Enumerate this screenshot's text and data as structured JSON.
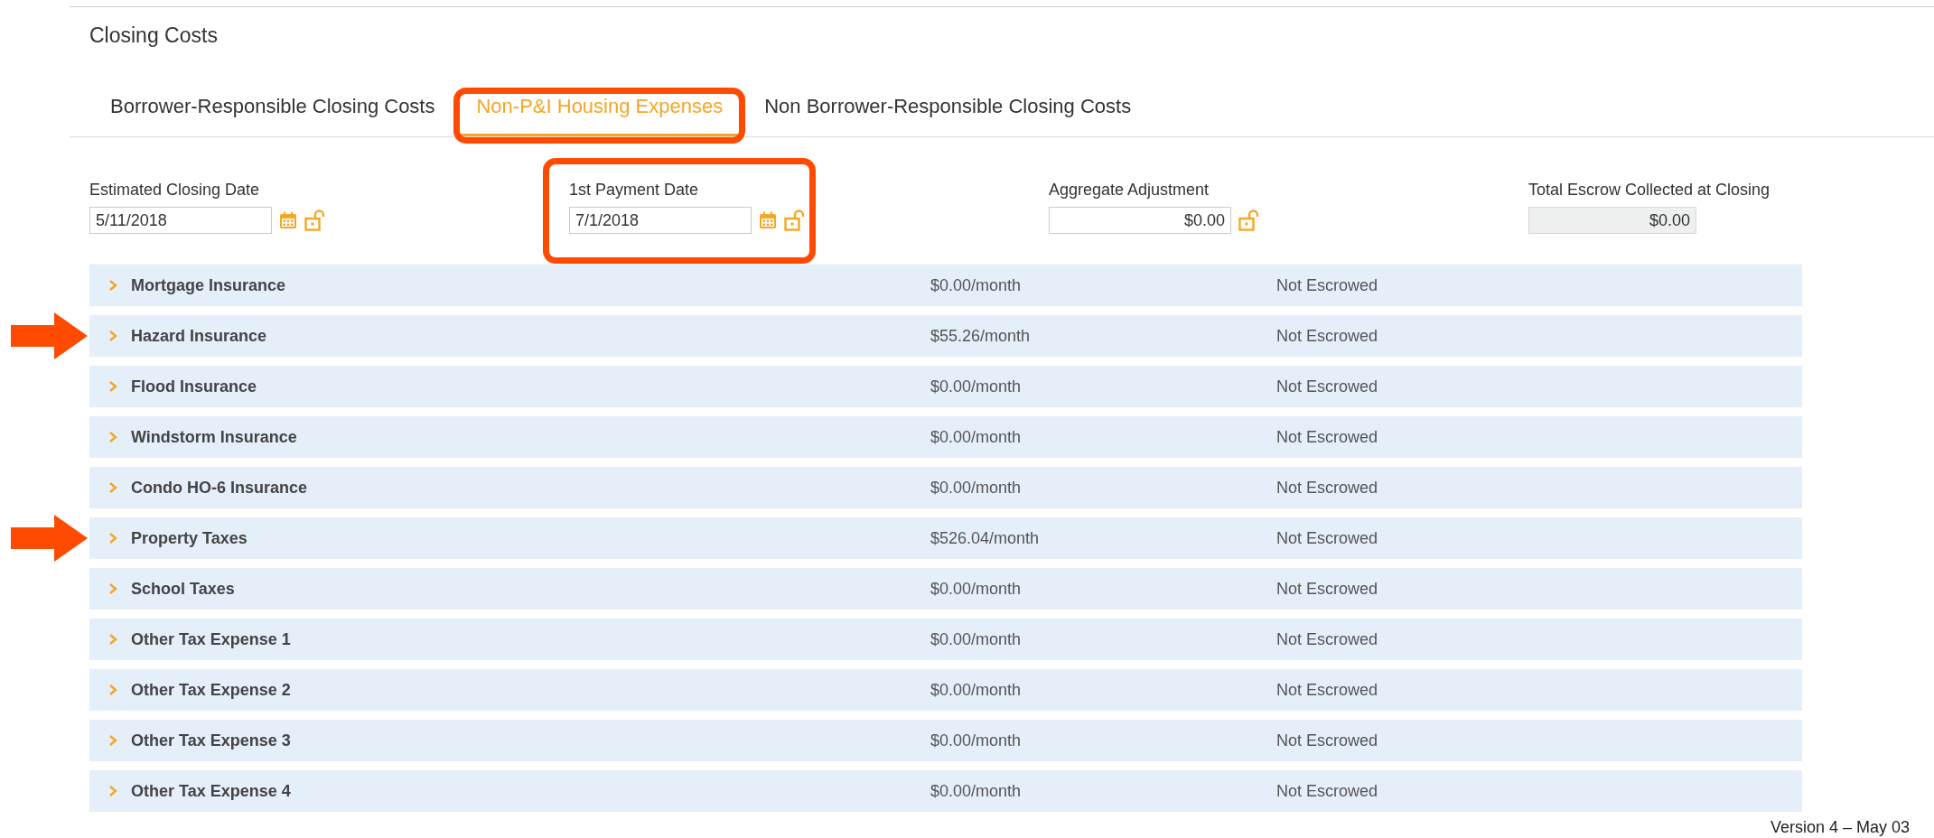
{
  "section": {
    "title": "Closing Costs"
  },
  "tabs": [
    {
      "label": "Borrower-Responsible Closing Costs",
      "selected": false,
      "highlighted": false
    },
    {
      "label": "Non-P&I Housing Expenses",
      "selected": true,
      "highlighted": true
    },
    {
      "label": "Non Borrower-Responsible Closing Costs",
      "selected": false,
      "highlighted": false
    }
  ],
  "fields": [
    {
      "label": "Estimated Closing Date",
      "value": "5/11/2018",
      "kind": "date",
      "highlighted": false
    },
    {
      "label": "1st Payment Date",
      "value": "7/1/2018",
      "kind": "date",
      "highlighted": true
    },
    {
      "label": "Aggregate Adjustment",
      "value": "$0.00",
      "kind": "amount",
      "highlighted": false
    },
    {
      "label": "Total Escrow Collected at Closing",
      "value": "$0.00",
      "kind": "readonly",
      "highlighted": false
    }
  ],
  "expenses": [
    {
      "name": "Mortgage Insurance",
      "amount": "$0.00/month",
      "status": "Not Escrowed",
      "expanded": false,
      "highlighted": false
    },
    {
      "name": "Hazard Insurance",
      "amount": "$55.26/month",
      "status": "Not Escrowed",
      "expanded": false,
      "highlighted": true
    },
    {
      "name": "Flood Insurance",
      "amount": "$0.00/month",
      "status": "Not Escrowed",
      "expanded": false,
      "highlighted": false
    },
    {
      "name": "Windstorm Insurance",
      "amount": "$0.00/month",
      "status": "Not Escrowed",
      "expanded": false,
      "highlighted": false
    },
    {
      "name": "Condo HO-6 Insurance",
      "amount": "$0.00/month",
      "status": "Not Escrowed",
      "expanded": false,
      "highlighted": false
    },
    {
      "name": "Property Taxes",
      "amount": "$526.04/month",
      "status": "Not Escrowed",
      "expanded": false,
      "highlighted": true
    },
    {
      "name": "School Taxes",
      "amount": "$0.00/month",
      "status": "Not Escrowed",
      "expanded": false,
      "highlighted": false
    },
    {
      "name": "Other Tax Expense 1",
      "amount": "$0.00/month",
      "status": "Not Escrowed",
      "expanded": false,
      "highlighted": false
    },
    {
      "name": "Other Tax Expense 2",
      "amount": "$0.00/month",
      "status": "Not Escrowed",
      "expanded": false,
      "highlighted": false
    },
    {
      "name": "Other Tax Expense 3",
      "amount": "$0.00/month",
      "status": "Not Escrowed",
      "expanded": false,
      "highlighted": false
    },
    {
      "name": "Other Tax Expense 4",
      "amount": "$0.00/month",
      "status": "Not Escrowed",
      "expanded": false,
      "highlighted": false
    }
  ],
  "footer": {
    "version": "Version 4 – May 03"
  }
}
